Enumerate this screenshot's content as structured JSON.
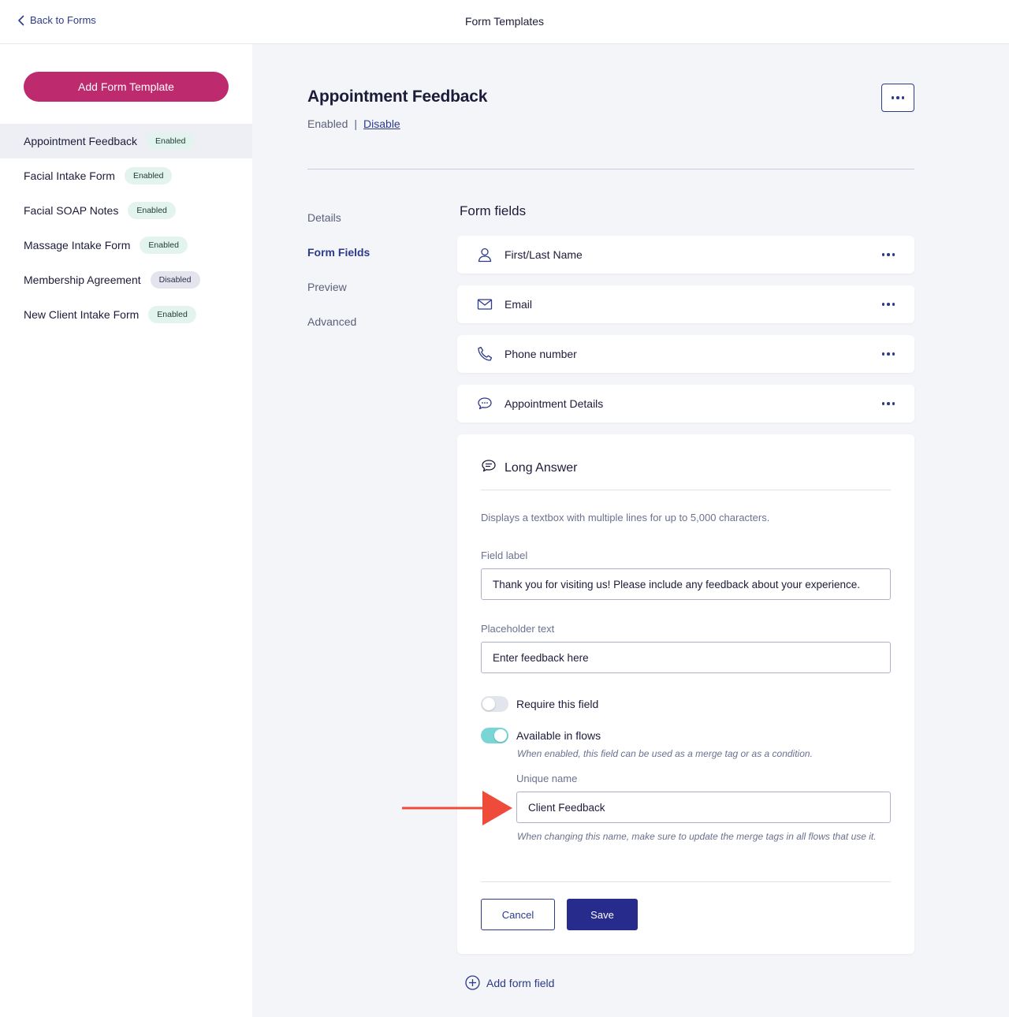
{
  "header": {
    "back_label": "Back to Forms",
    "title": "Form Templates"
  },
  "sidebar": {
    "add_button": "Add Form Template",
    "templates": [
      {
        "name": "Appointment Feedback",
        "status": "Enabled"
      },
      {
        "name": "Facial Intake Form",
        "status": "Enabled"
      },
      {
        "name": "Facial SOAP Notes",
        "status": "Enabled"
      },
      {
        "name": "Massage Intake Form",
        "status": "Enabled"
      },
      {
        "name": "Membership Agreement",
        "status": "Disabled"
      },
      {
        "name": "New Client Intake Form",
        "status": "Enabled"
      }
    ]
  },
  "main": {
    "title": "Appointment Feedback",
    "status": "Enabled",
    "separator": "|",
    "disable_label": "Disable",
    "tabs": [
      "Details",
      "Form Fields",
      "Preview",
      "Advanced"
    ],
    "section_title": "Form fields",
    "fields": [
      {
        "label": "First/Last Name",
        "icon": "user-icon"
      },
      {
        "label": "Email",
        "icon": "mail-icon"
      },
      {
        "label": "Phone number",
        "icon": "phone-icon"
      },
      {
        "label": "Appointment Details",
        "icon": "chat-bubble-icon"
      }
    ],
    "editor": {
      "title": "Long Answer",
      "icon": "long-answer-icon",
      "description": "Displays a textbox with multiple lines for up to 5,000 characters.",
      "field_label_caption": "Field label",
      "field_label_value": "Thank you for visiting us! Please include any feedback about your experience.",
      "placeholder_caption": "Placeholder text",
      "placeholder_value": "Enter feedback here",
      "require_label": "Require this field",
      "require_on": false,
      "flows_label": "Available in flows",
      "flows_on": true,
      "flows_hint": "When enabled, this field can be used as a merge tag or as a condition.",
      "unique_caption": "Unique name",
      "unique_value": "Client Feedback",
      "unique_hint": "When changing this name, make sure to update the merge tags in all flows that use it.",
      "cancel_label": "Cancel",
      "save_label": "Save"
    },
    "add_field_label": "Add form field"
  },
  "colors": {
    "brand_pink": "#be2a6e",
    "primary_navy": "#262b8c",
    "link_blue": "#2c3a8a",
    "toggle_on": "#7ad6d6",
    "annotation_arrow": "#ee4b3b"
  }
}
